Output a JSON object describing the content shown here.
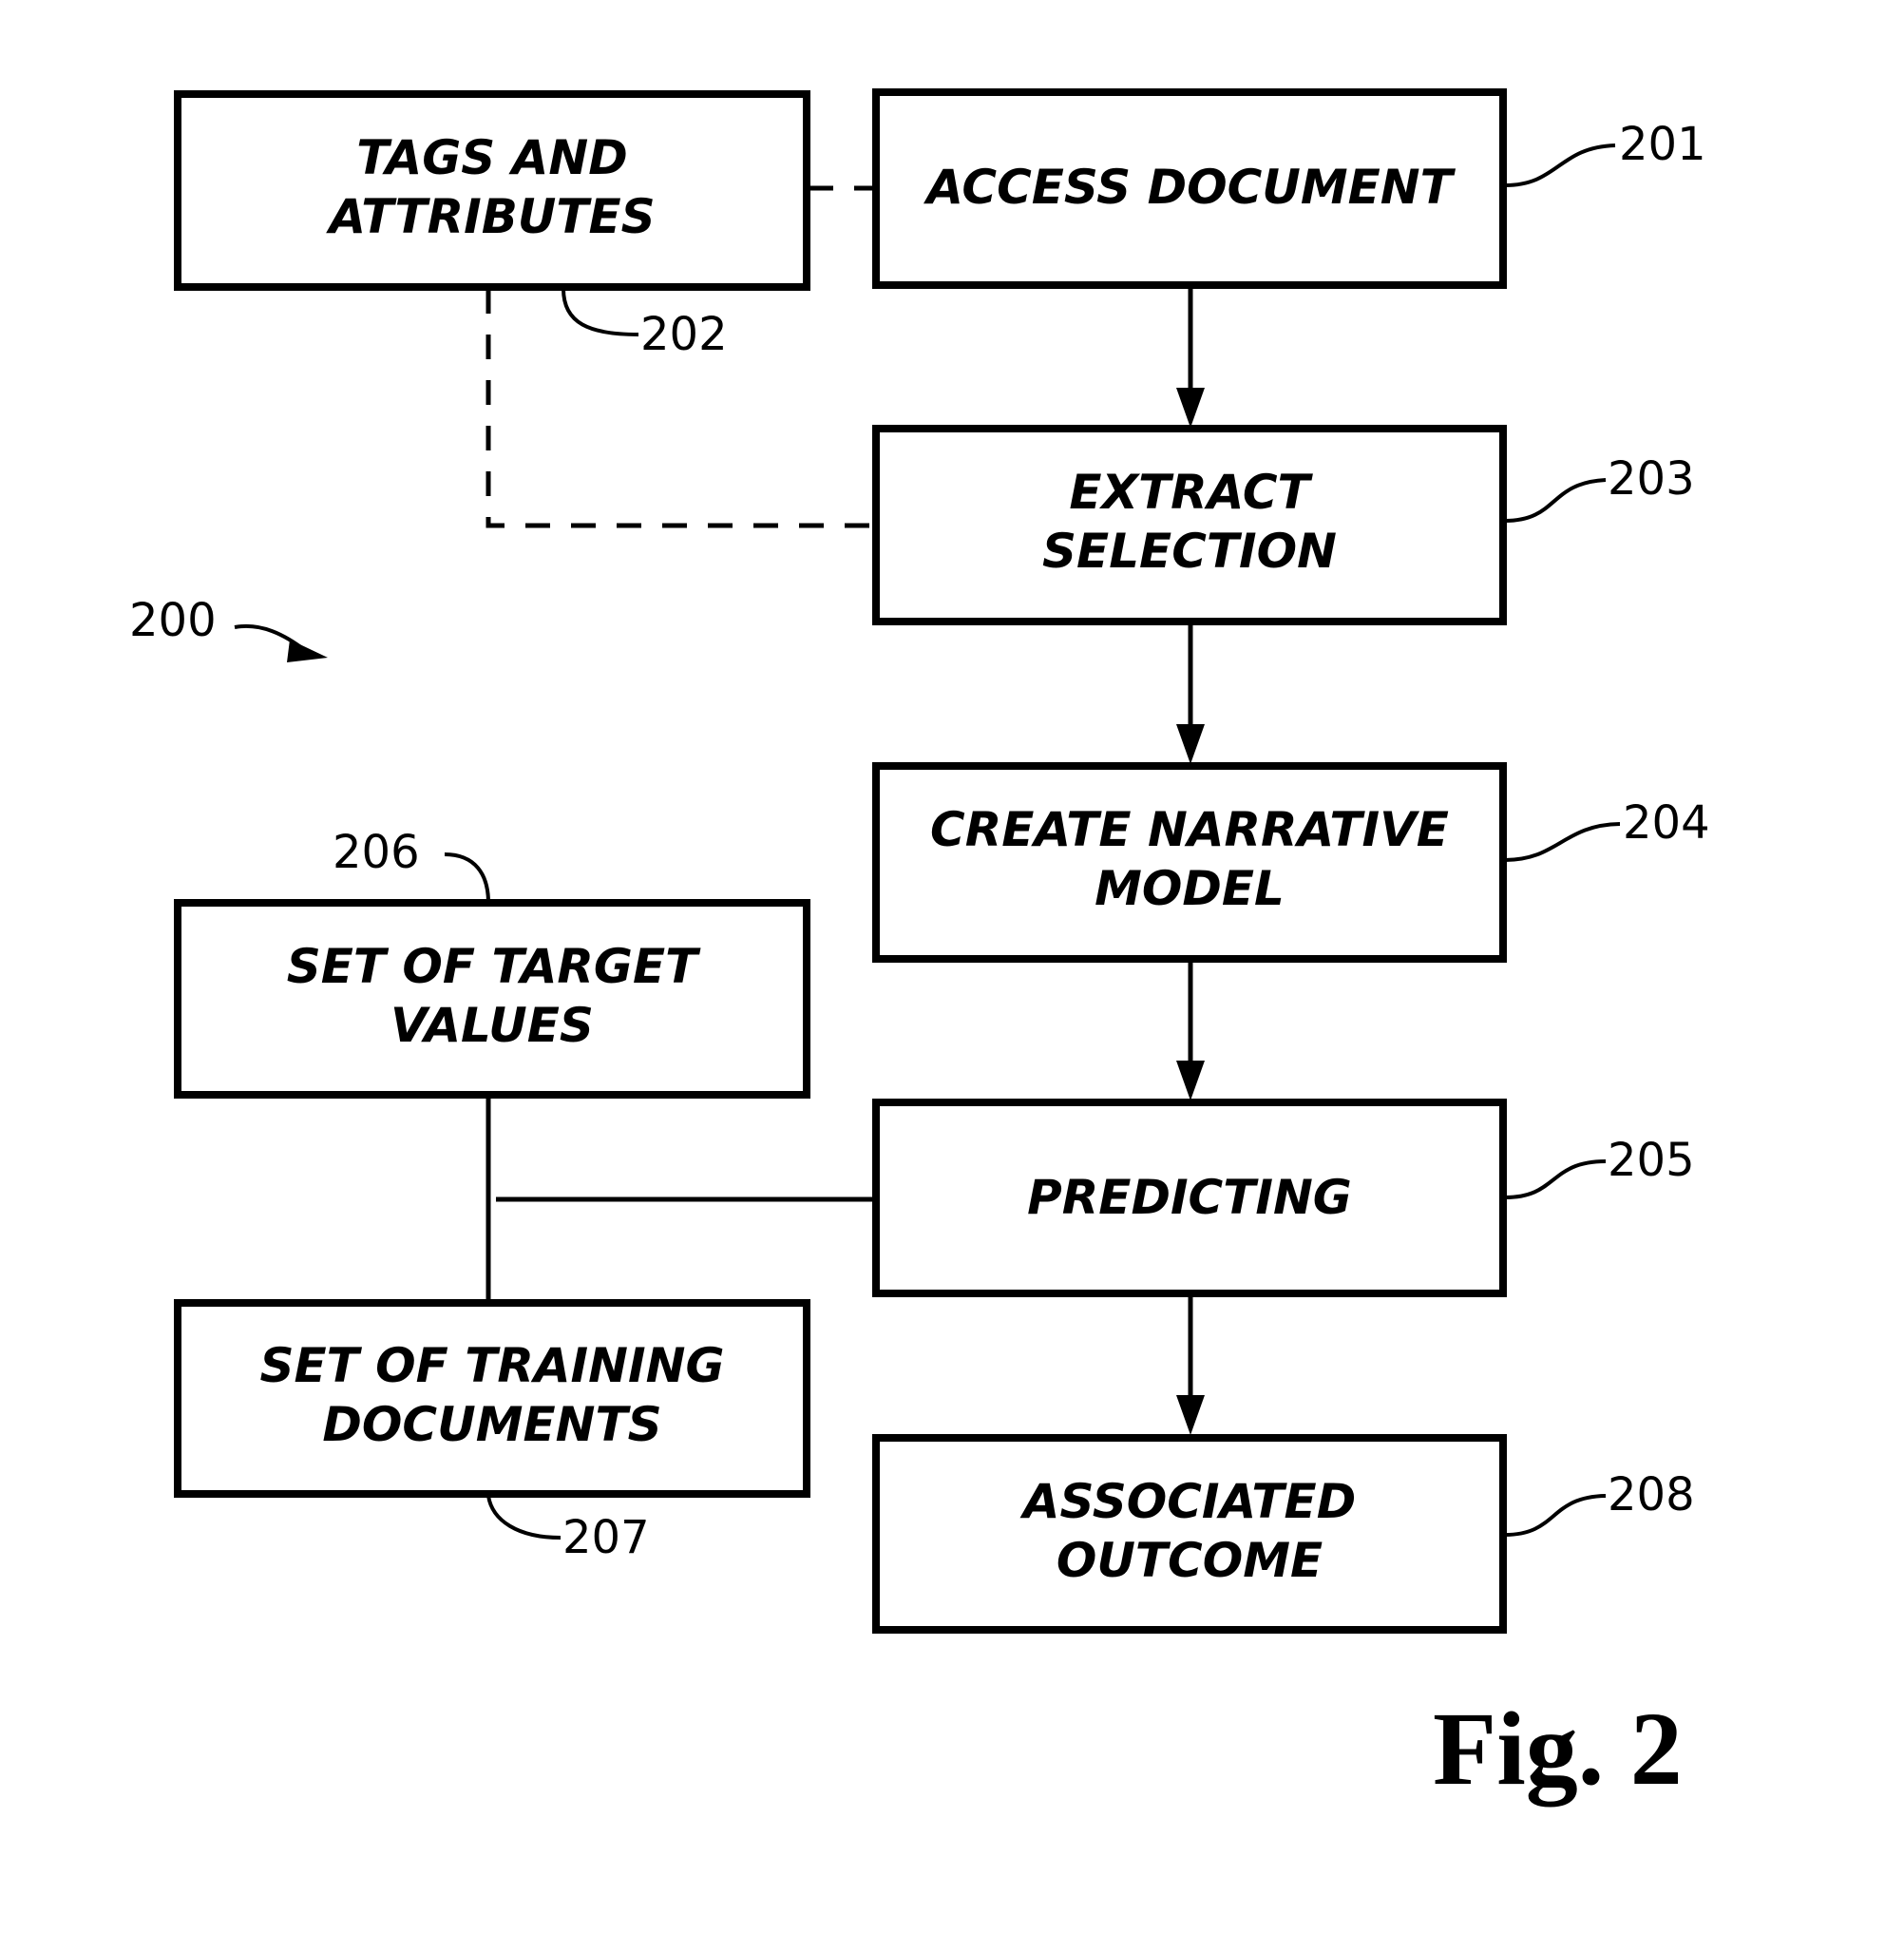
{
  "diagram": {
    "reference_number": "200",
    "figure_label": "Fig. 2",
    "nodes": [
      {
        "id": "201",
        "lines": [
          "ACCESS DOCUMENT"
        ],
        "ref": "201"
      },
      {
        "id": "202",
        "lines": [
          "TAGS AND",
          "ATTRIBUTES"
        ],
        "ref": "202"
      },
      {
        "id": "203",
        "lines": [
          "EXTRACT",
          "SELECTION"
        ],
        "ref": "203"
      },
      {
        "id": "204",
        "lines": [
          "CREATE NARRATIVE",
          "MODEL"
        ],
        "ref": "204"
      },
      {
        "id": "205",
        "lines": [
          "PREDICTING"
        ],
        "ref": "205"
      },
      {
        "id": "206",
        "lines": [
          "SET OF TARGET",
          "VALUES"
        ],
        "ref": "206"
      },
      {
        "id": "207",
        "lines": [
          "SET OF TRAINING",
          "DOCUMENTS"
        ],
        "ref": "207"
      },
      {
        "id": "208",
        "lines": [
          "ASSOCIATED",
          "OUTCOME"
        ],
        "ref": "208"
      }
    ],
    "edges": [
      {
        "from": "201",
        "to": "203",
        "style": "arrow"
      },
      {
        "from": "203",
        "to": "204",
        "style": "arrow"
      },
      {
        "from": "204",
        "to": "205",
        "style": "arrow"
      },
      {
        "from": "205",
        "to": "208",
        "style": "arrow"
      },
      {
        "from": "202",
        "to": "201",
        "style": "dashed"
      },
      {
        "from": "202",
        "to": "203",
        "style": "dashed"
      },
      {
        "from": "206",
        "to": "207",
        "style": "solid"
      },
      {
        "from": "205",
        "to": "206-207-link",
        "style": "solid"
      }
    ]
  }
}
